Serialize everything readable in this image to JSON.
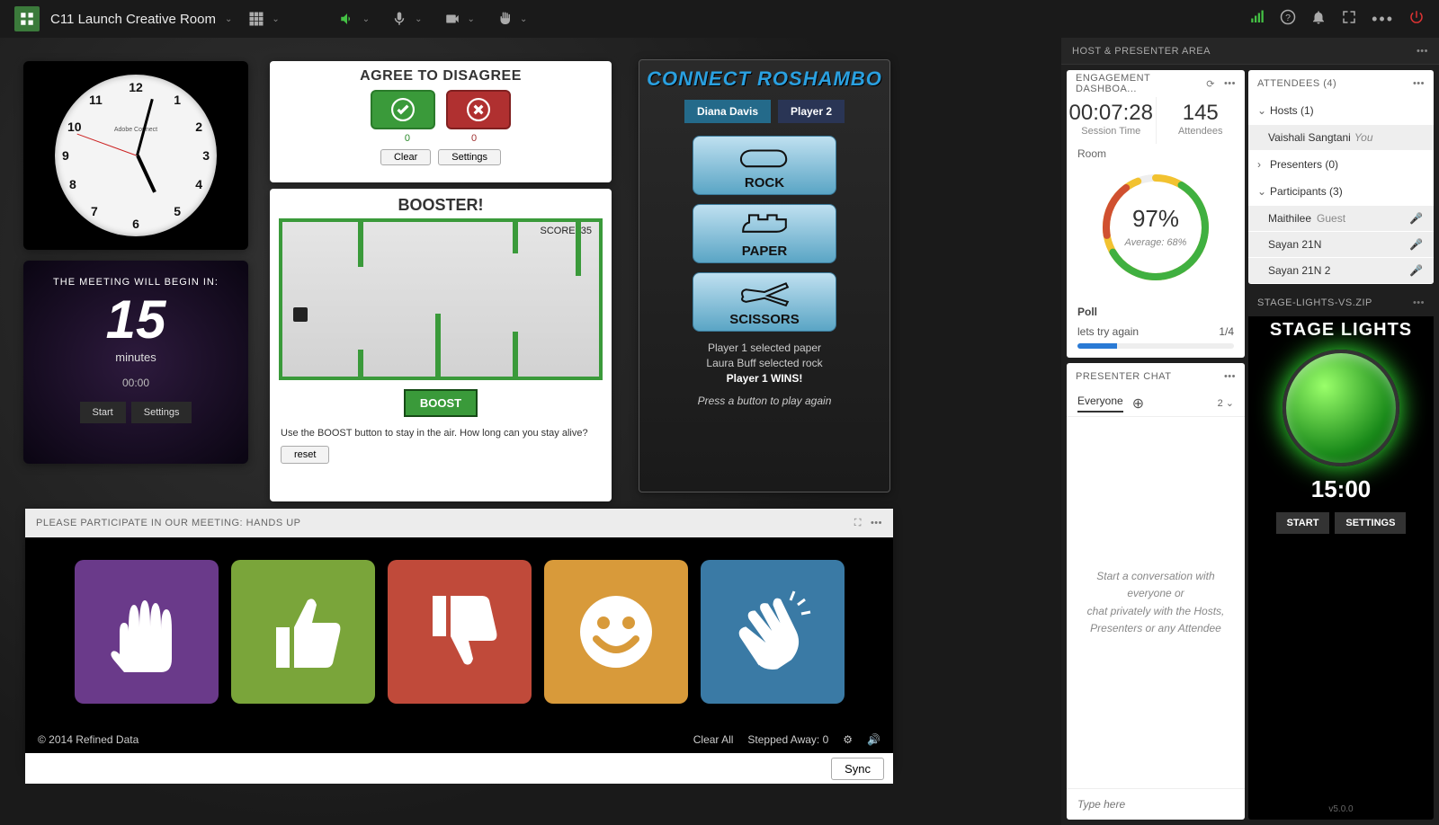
{
  "topbar": {
    "room_name": "C11 Launch Creative Room"
  },
  "clock": {
    "brand": "Adobe Connect"
  },
  "countdown": {
    "label": "THE MEETING WILL BEGIN IN:",
    "value": "15",
    "unit": "minutes",
    "timer": "00:00",
    "start_btn": "Start",
    "settings_btn": "Settings"
  },
  "agree": {
    "title": "AGREE TO DISAGREE",
    "yes_count": "0",
    "no_count": "0",
    "clear_btn": "Clear",
    "settings_btn": "Settings"
  },
  "booster": {
    "title": "BOOSTER!",
    "score_label": "SCORE: 35",
    "boost_btn": "BOOST",
    "instructions": "Use the BOOST button to stay in the air. How long can you stay alive?",
    "reset_btn": "reset"
  },
  "rps": {
    "title": "CONNECT ROSHAMBO",
    "p1": "Diana Davis",
    "p2": "Player 2",
    "rock": "ROCK",
    "paper": "PAPER",
    "scissors": "SCISSORS",
    "log1": "Player 1 selected paper",
    "log2": "Laura Buff selected rock",
    "log3": "Player 1 WINS!",
    "prompt": "Press a button to play again"
  },
  "hands": {
    "title": "PLEASE PARTICIPATE IN OUR MEETING: HANDS UP",
    "copyright": "© 2014 Refined Data",
    "clear_all": "Clear All",
    "stepped_away": "Stepped Away: 0",
    "sync_btn": "Sync"
  },
  "host_area_title": "HOST & PRESENTER AREA",
  "engage": {
    "title": "ENGAGEMENT DASHBOA...",
    "session_time": "00:07:28",
    "session_label": "Session Time",
    "attendees": "145",
    "attendees_label": "Attendees",
    "room_label": "Room",
    "pct": "97%",
    "avg": "Average: 68%",
    "poll_label": "Poll",
    "poll_text": "lets try again",
    "poll_count": "1/4"
  },
  "pchat": {
    "title": "PRESENTER CHAT",
    "tab": "Everyone",
    "count": "2",
    "placeholder_msg": "Start a conversation with everyone or\nchat privately with the Hosts, Presenters or any Attendee",
    "input_placeholder": "Type here"
  },
  "attendees": {
    "title": "ATTENDEES  (4)",
    "hosts_label": "Hosts (1)",
    "presenters_label": "Presenters (0)",
    "participants_label": "Participants (3)",
    "host1": "Vaishali Sangtani",
    "you_label": "You",
    "guest_label": "Guest",
    "part1": "Maithilee",
    "part2": "Sayan 21N",
    "part3": "Sayan 21N 2"
  },
  "stage": {
    "title": "STAGE-LIGHTS-VS.ZIP",
    "heading": "STAGE LIGHTS",
    "time": "15:00",
    "start_btn": "START",
    "settings_btn": "SETTINGS",
    "version": "v5.0.0"
  }
}
